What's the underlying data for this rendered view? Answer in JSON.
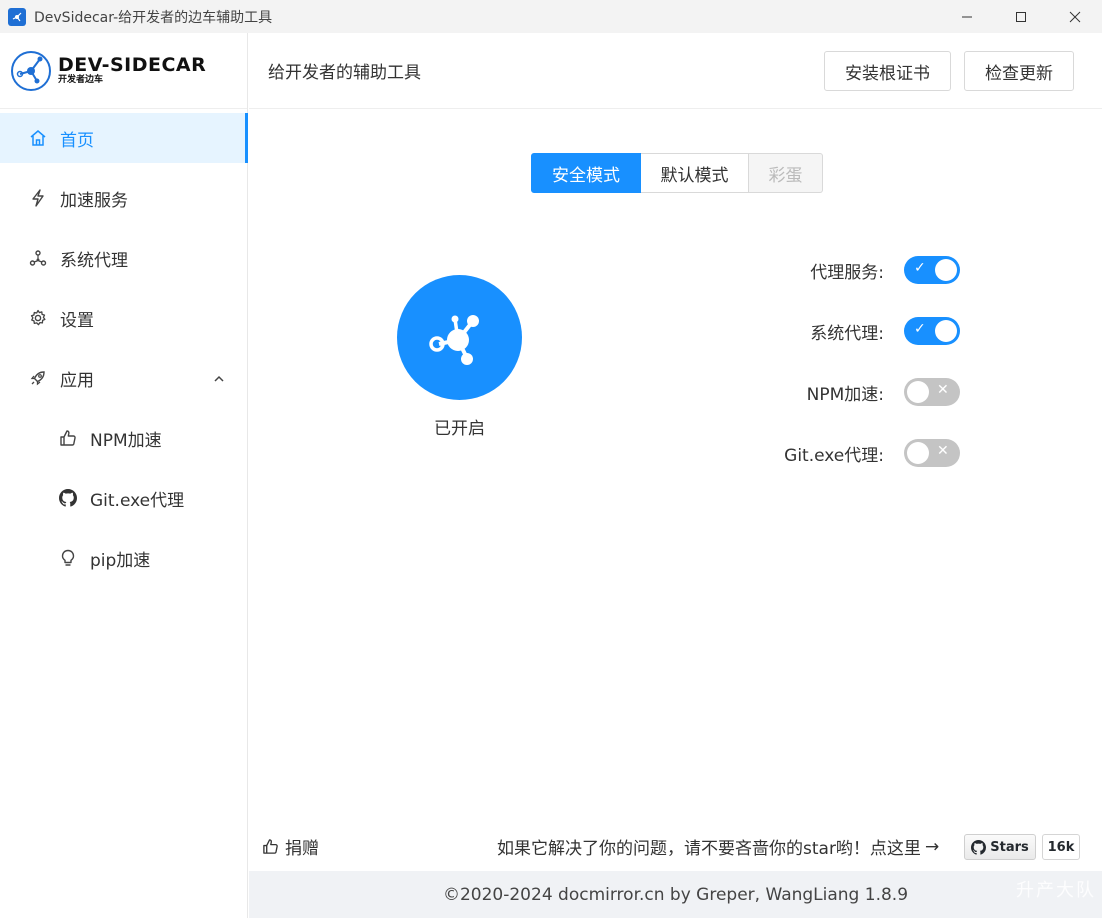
{
  "window": {
    "title": "DevSidecar-给开发者的边车辅助工具"
  },
  "logo": {
    "brand": "DEV-SIDECAR",
    "subtitle": "开发者边车"
  },
  "sidebar": {
    "items": [
      {
        "label": "首页",
        "icon": "home-icon"
      },
      {
        "label": "加速服务",
        "icon": "lightning-icon"
      },
      {
        "label": "系统代理",
        "icon": "network-icon"
      },
      {
        "label": "设置",
        "icon": "gear-icon"
      },
      {
        "label": "应用",
        "icon": "rocket-icon"
      },
      {
        "label": "NPM加速",
        "icon": "thumbs-up-icon"
      },
      {
        "label": "Git.exe代理",
        "icon": "github-icon"
      },
      {
        "label": "pip加速",
        "icon": "bulb-icon"
      }
    ]
  },
  "header": {
    "title": "给开发者的辅助工具",
    "install_cert": "安装根证书",
    "check_update": "检查更新"
  },
  "modes": {
    "safe": "安全模式",
    "default": "默认模式",
    "easter_egg": "彩蛋"
  },
  "main": {
    "status": "已开启"
  },
  "options": [
    {
      "label": "代理服务:",
      "on": true
    },
    {
      "label": "系统代理:",
      "on": true
    },
    {
      "label": "NPM加速:",
      "on": false
    },
    {
      "label": "Git.exe代理:",
      "on": false
    }
  ],
  "toggle_marks": {
    "on": "✓",
    "off": "✕"
  },
  "bottom": {
    "donate": "捐赠",
    "star_message": "如果它解决了你的问题，请不要吝啬你的star哟！点这里",
    "arrow": "→",
    "stars_label": "Stars",
    "stars_count": "16k"
  },
  "footer": {
    "copyright": "©2020-2024 docmirror.cn by Greper, WangLiang 1.8.9"
  },
  "watermark": "升产大队",
  "colors": {
    "accent": "#1890ff",
    "toggle_off": "#c4c4c4",
    "footer_bg": "#f0f2f5"
  }
}
